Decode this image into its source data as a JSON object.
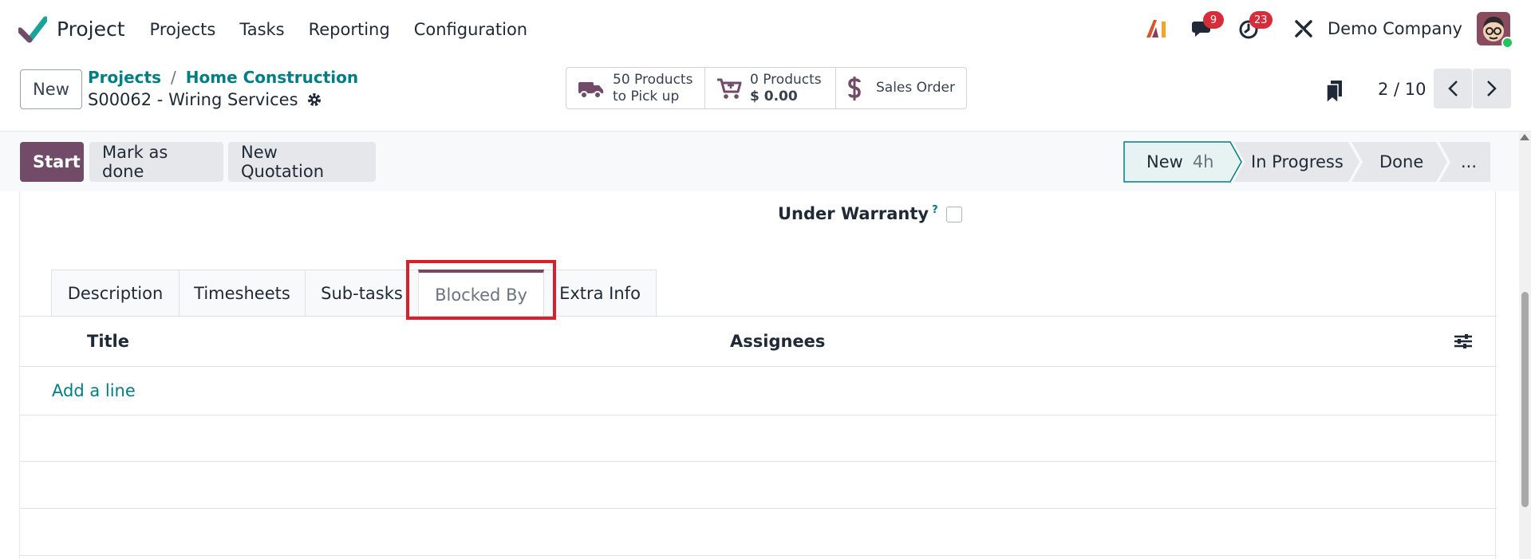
{
  "navbar": {
    "app_name": "Project",
    "menu": [
      "Projects",
      "Tasks",
      "Reporting",
      "Configuration"
    ],
    "messages_count": "9",
    "activities_count": "23",
    "company": "Demo Company"
  },
  "control": {
    "new_label": "New",
    "breadcrumb": [
      "Projects",
      "Home Construction"
    ],
    "breadcrumb_sep": "/",
    "record_title": "S00062 - Wiring Services",
    "smart_buttons": [
      {
        "line1": "50 Products",
        "line2": "to Pick up",
        "icon": "truck-icon"
      },
      {
        "line1": "0 Products",
        "line2": "$ 0.00",
        "icon": "cart-icon"
      },
      {
        "line1": "Sales Order",
        "icon": "dollar-icon"
      }
    ],
    "pager": "2 / 10"
  },
  "statusbar": {
    "actions": [
      "Start",
      "Mark as done",
      "New Quotation"
    ],
    "stages": [
      {
        "label": "New",
        "time": "4h",
        "active": true
      },
      {
        "label": "In Progress"
      },
      {
        "label": "Done"
      },
      {
        "label": "..."
      }
    ]
  },
  "form": {
    "warranty_label": "Under Warranty",
    "warranty_help": "?",
    "warranty_checked": false
  },
  "tabs": [
    "Description",
    "Timesheets",
    "Sub-tasks",
    "Blocked By",
    "Extra Info"
  ],
  "active_tab": "Blocked By",
  "list": {
    "columns": [
      "Title",
      "Assignees"
    ],
    "add_line": "Add a line"
  },
  "colors": {
    "primary": "#714b67",
    "link": "#017e84",
    "highlight": "#d6202b",
    "badge": "#d62d3a"
  }
}
